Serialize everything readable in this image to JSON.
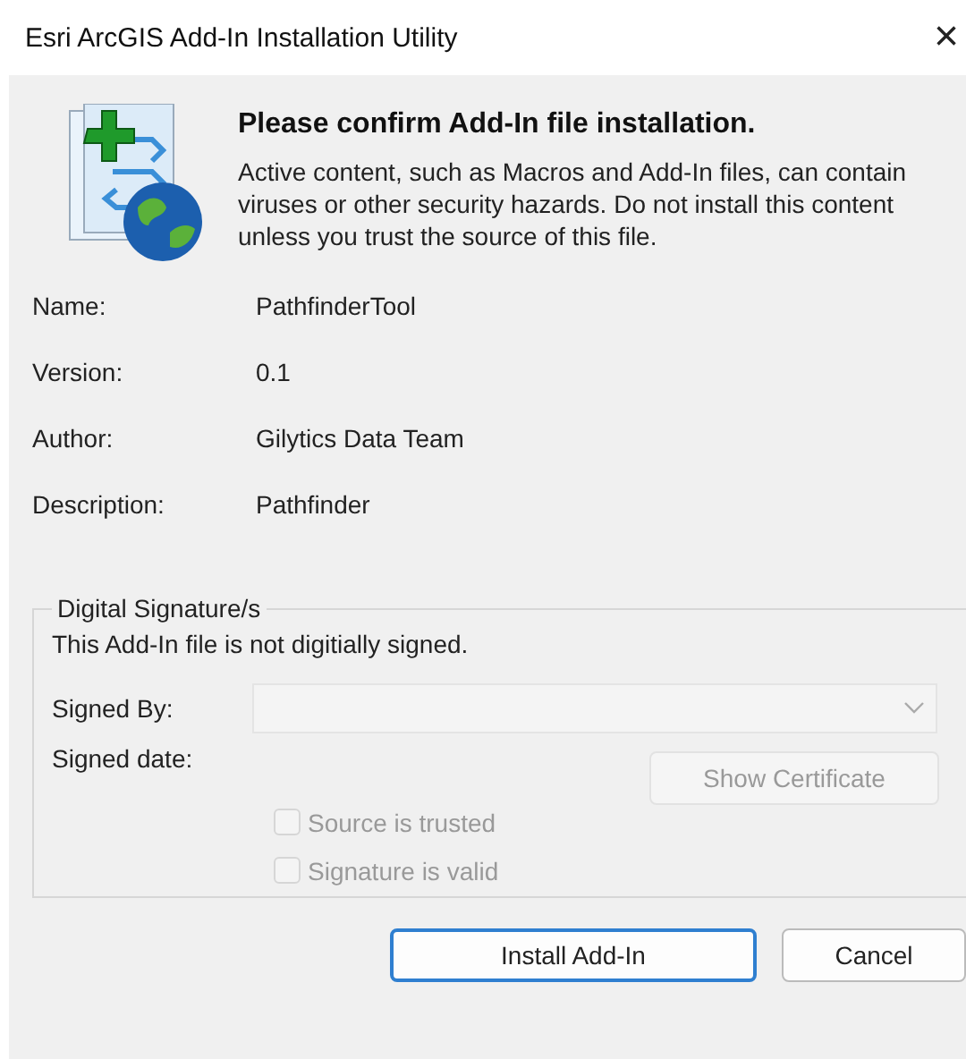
{
  "window": {
    "title": "Esri ArcGIS Add-In Installation Utility",
    "close": "×"
  },
  "heading": "Please confirm Add-In file installation.",
  "warning": "Active content, such as Macros and Add-In files, can contain viruses or other security hazards.  Do not install this content unless you trust the source of this file.",
  "fields": [
    {
      "label": "Name:",
      "value": "PathfinderTool"
    },
    {
      "label": "Version:",
      "value": "0.1"
    },
    {
      "label": "Author:",
      "value": "Gilytics Data Team"
    },
    {
      "label": "Description:",
      "value": "Pathfinder"
    }
  ],
  "signature": {
    "title": "Digital Signature/s",
    "status": "This Add-In file is not digitially signed.",
    "signed_by": {
      "label": "Signed By:",
      "disabled": true
    },
    "signed_date": {
      "label": "Signed date:"
    },
    "show_certificate": {
      "label": "Show Certificate",
      "disabled": true
    },
    "checks": [
      {
        "label": "Source is trusted",
        "checked": false,
        "disabled": true
      },
      {
        "label": "Signature is valid",
        "checked": false,
        "disabled": true
      }
    ]
  },
  "buttons": [
    {
      "label": "Install Add-In",
      "default": true
    },
    {
      "label": "Cancel",
      "default": false
    }
  ]
}
